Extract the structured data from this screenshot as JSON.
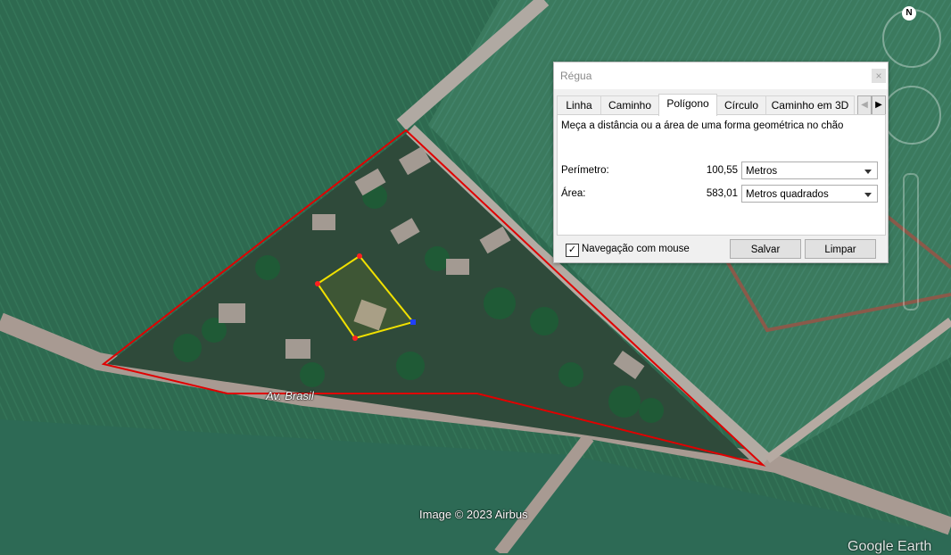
{
  "map": {
    "street_label": "Av. Brasil",
    "credit": "Image © 2023 Airbus",
    "brand": "Google Earth"
  },
  "nav": {
    "north": "N"
  },
  "ruler": {
    "title": "Régua",
    "close": "×",
    "tabs": [
      "Linha",
      "Caminho",
      "Polígono",
      "Círculo",
      "Caminho em 3D"
    ],
    "active_tab": "Polígono",
    "description": "Meça a distância ou a área de uma forma geométrica no chão",
    "perimeter": {
      "label": "Perímetro:",
      "value": "100,55",
      "unit": "Metros"
    },
    "area": {
      "label": "Área:",
      "value": "583,01",
      "unit": "Metros quadrados"
    },
    "mouse_nav": {
      "label": "Navegação com mouse",
      "checked": true,
      "mark": "✓"
    },
    "save": "Salvar",
    "clear": "Limpar",
    "scroll_left": "◀",
    "scroll_right": "▶"
  },
  "colors": {
    "outline": "#e00000",
    "measure": "#f0e000",
    "vertex": "#ff2020",
    "vertex_active": "#2040ff"
  }
}
